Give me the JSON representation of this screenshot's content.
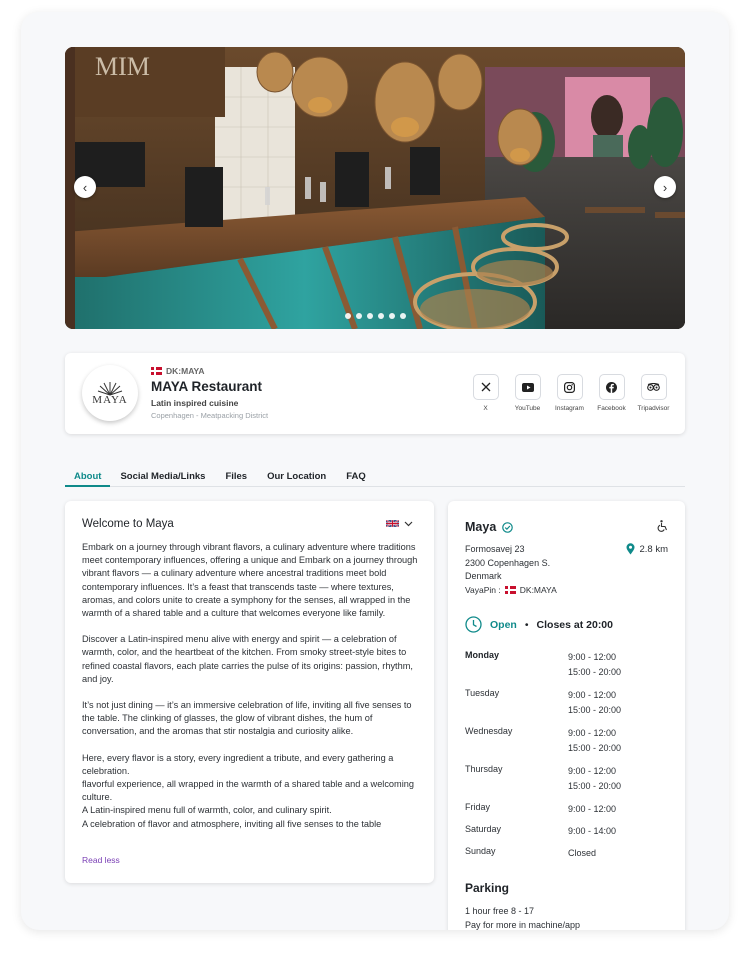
{
  "hero": {
    "prev_icon": "chevron-left-icon",
    "next_icon": "chevron-right-icon",
    "slide_count": 6,
    "active_slide": 1
  },
  "profile": {
    "logo_text": "MAYA",
    "country_code": "DK:MAYA",
    "name": "MAYA Restaurant",
    "subtitle": "Latin inspired cuisine",
    "location": "Copenhagen - Meatpacking District",
    "socials": [
      {
        "label": "X",
        "icon": "x-icon"
      },
      {
        "label": "YouTube",
        "icon": "youtube-icon"
      },
      {
        "label": "Instagram",
        "icon": "instagram-icon"
      },
      {
        "label": "Facebook",
        "icon": "facebook-icon"
      },
      {
        "label": "Tripadvisor",
        "icon": "tripadvisor-icon"
      }
    ]
  },
  "tabs": [
    "About",
    "Social Media/Links",
    "Files",
    "Our Location",
    "FAQ"
  ],
  "active_tab": "About",
  "about": {
    "title": "Welcome to Maya",
    "paragraphs": [
      "Embark on a journey through vibrant flavors, a culinary adventure where traditions meet contemporary influences, offering a unique and Embark on a journey through vibrant flavors — a culinary adventure where ancestral traditions meet bold contemporary influences.  It’s a feast that transcends taste — where textures, aromas, and colors unite to create a symphony for the senses, all wrapped in the warmth of a shared table and a culture that welcomes everyone like family.",
      "Discover a Latin-inspired menu alive with energy and spirit — a celebration of warmth, color, and the heartbeat of the kitchen. From smoky street-style bites to refined coastal flavors, each plate carries the pulse of its origins: passion, rhythm, and joy.",
      "It’s not just dining — it’s an immersive celebration of life, inviting all five senses to the table. The clinking of glasses, the glow of vibrant dishes, the hum of conversation, and the aromas that stir nostalgia and curiosity alike."
    ],
    "closing_lines": [
      "Here, every flavor is a story, every ingredient a tribute, and every gathering a celebration.",
      "flavorful experience, all wrapped in the warmth of a shared table and a welcoming culture.",
      "A Latin-inspired menu full of warmth, color, and culinary spirit.",
      "A celebration of flavor and atmosphere, inviting all five senses to the table"
    ],
    "read_less": "Read less"
  },
  "info": {
    "name": "Maya",
    "address": [
      "Formosavej 23",
      "2300 Copenhagen S.",
      "Denmark"
    ],
    "distance": "2.8 km",
    "vayapin_label": "VayaPin :",
    "vayapin_code": "DK:MAYA",
    "status": "Open",
    "separator": "•",
    "closes": "Closes at 20:00",
    "hours": [
      {
        "day": "Monday",
        "times": [
          "9:00 - 12:00",
          "15:00 - 20:00"
        ]
      },
      {
        "day": "Tuesday",
        "times": [
          "9:00 - 12:00",
          "15:00 - 20:00"
        ]
      },
      {
        "day": "Wednesday",
        "times": [
          "9:00 - 12:00",
          "15:00 - 20:00"
        ]
      },
      {
        "day": "Thursday",
        "times": [
          "9:00 - 12:00",
          "15:00 - 20:00"
        ]
      },
      {
        "day": "Friday",
        "times": [
          "9:00 - 12:00"
        ]
      },
      {
        "day": "Saturday",
        "times": [
          "9:00 - 14:00"
        ]
      },
      {
        "day": "Sunday",
        "times": [
          "Closed"
        ]
      }
    ],
    "parking_title": "Parking",
    "parking_lines": [
      "1 hour free 8 - 17",
      "Pay for more in machine/app"
    ]
  },
  "colors": {
    "accent": "#0f8a8a",
    "link": "#7a3fb5",
    "danish_red": "#c8102e"
  }
}
